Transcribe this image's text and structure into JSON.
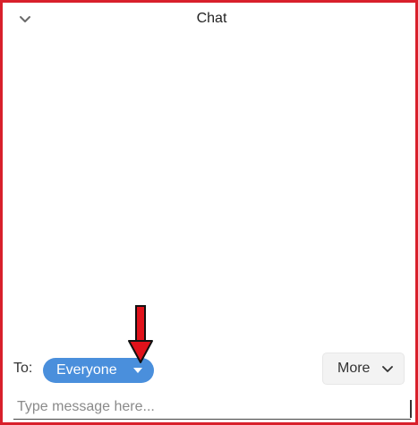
{
  "header": {
    "title": "Chat",
    "collapse_icon": "chevron-down-icon"
  },
  "recipient": {
    "to_label": "To:",
    "selected": "Everyone",
    "dropdown_icon": "caret-down-icon"
  },
  "more_button": {
    "label": "More",
    "icon": "chevron-down-icon"
  },
  "message_input": {
    "placeholder": "Type message here...",
    "value": ""
  },
  "annotation": {
    "icon": "down-arrow-icon",
    "color": "#e0121b"
  },
  "colors": {
    "frame_border": "#d8202b",
    "pill_background": "#4a8fdc",
    "button_background": "#f3f3f3"
  }
}
